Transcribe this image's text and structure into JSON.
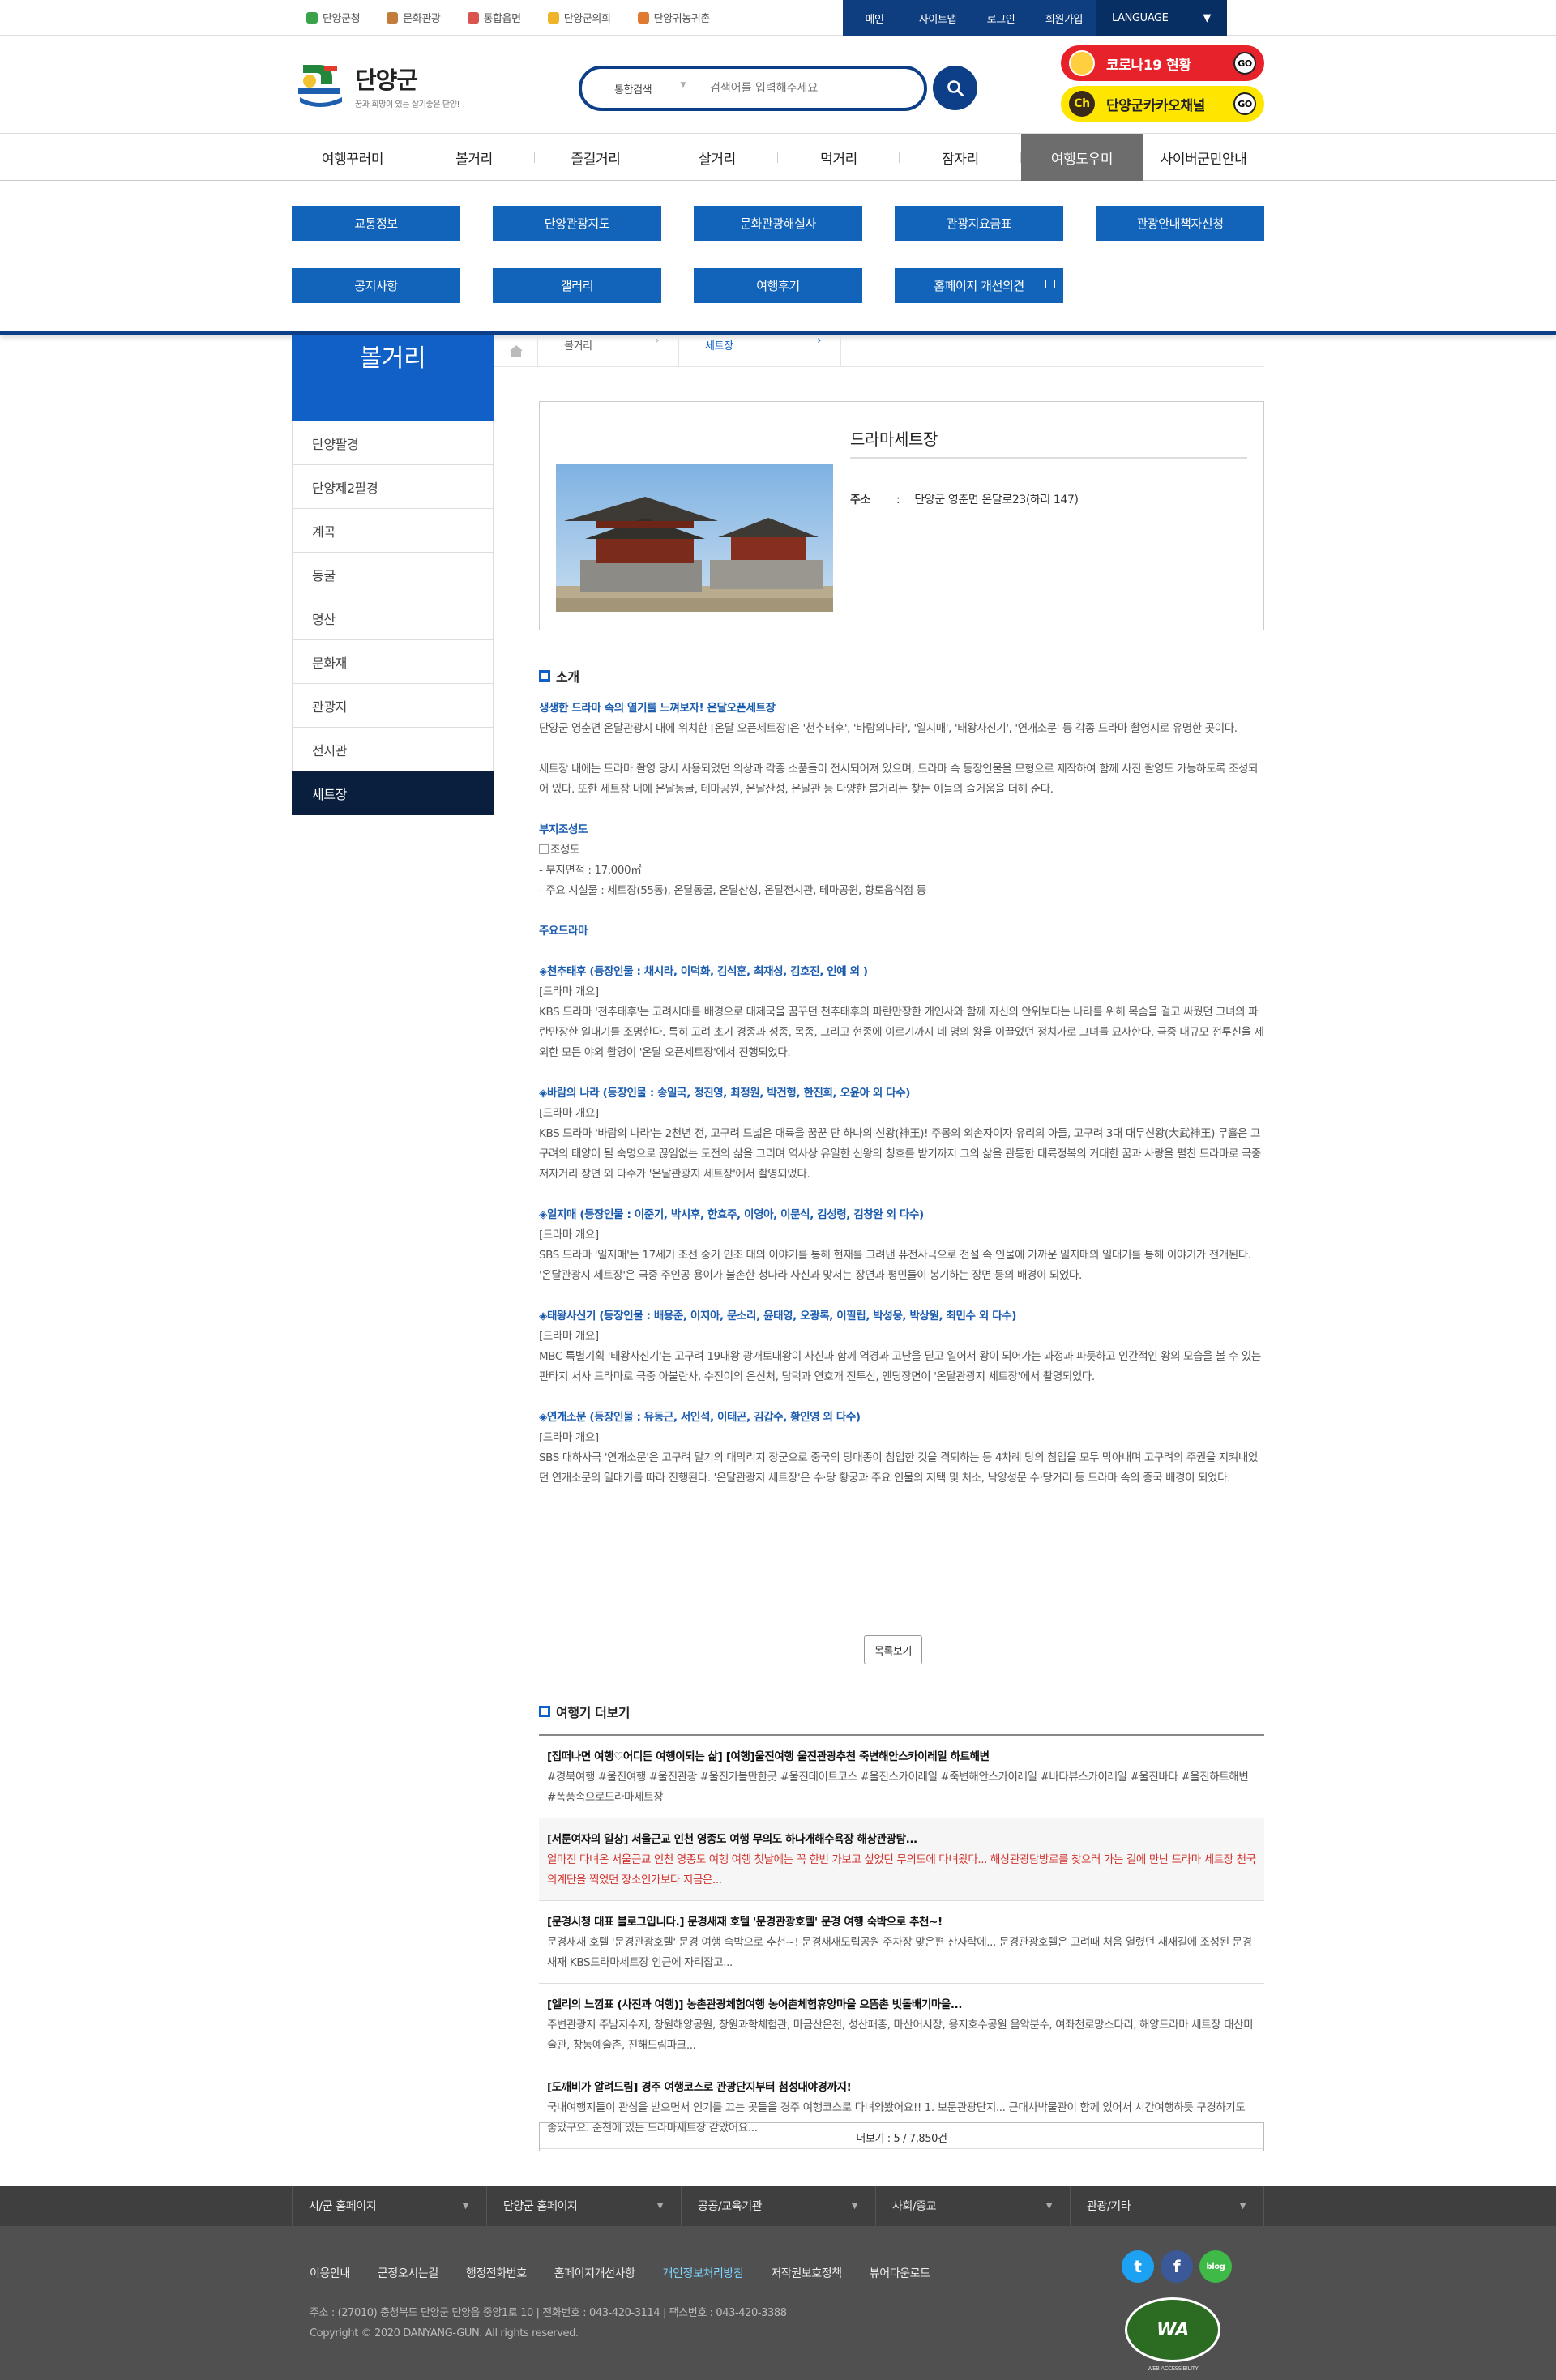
{
  "topbar": {
    "links": [
      "단양군청",
      "문화관광",
      "통합읍면",
      "단양군의회",
      "단양귀농귀촌"
    ],
    "right": [
      "메인",
      "사이트맵",
      "로그인",
      "회원가입"
    ],
    "language": "LANGUAGE"
  },
  "header": {
    "logo_name": "단양군",
    "logo_slogan": "꿈과 희망이 있는 살기좋은 단양!",
    "search_select": "통합검색",
    "search_placeholder": "검색어를 입력해주세요",
    "covid_label": "코로나19 현황",
    "kakao_label": "단양군카카오채널",
    "go": "GO"
  },
  "gnb": [
    "여행꾸러미",
    "볼거리",
    "즐길거리",
    "살거리",
    "먹거리",
    "잠자리",
    "여행도우미",
    "사이버군민안내"
  ],
  "submenu": [
    "교통정보",
    "단양관광지도",
    "문화관광해설사",
    "관광지요금표",
    "관광안내책자신청",
    "공지사항",
    "갤러리",
    "여행후기",
    "홈페이지 개선의견"
  ],
  "lnb": {
    "title": "볼거리",
    "items": [
      "단양팔경",
      "단양제2팔경",
      "계곡",
      "동굴",
      "명산",
      "문화재",
      "관광지",
      "전시관",
      "세트장"
    ]
  },
  "breadcrumb": [
    "볼거리",
    "세트장"
  ],
  "info": {
    "title": "드라마세트장",
    "addr_label": "주소",
    "addr_sep": ":",
    "addr_value": "단양군 영춘면 온달로23(하리 147)"
  },
  "intro": {
    "heading": "소개",
    "lead": "생생한 드라마 속의 열기를 느껴보자! 온달오픈세트장",
    "p1": "단양군 영춘면 온달관광지 내에 위치한 [온달 오픈세트장]은 '천추태후', '바람의나라', '일지매', '태왕사신기', '연개소문' 등 각종 드라마 촬영지로 유명한 곳이다.",
    "p2": "세트장 내에는 드라마 촬영 당시 사용되었던 의상과 각종 소품들이 전시되어져 있으며, 드라마 속 등장인물을 모형으로 제작하여 함께 사진 촬영도 가능하도록 조성되어 있다. 또한 세트장 내에 온달동굴, 테마공원, 온달산성, 온달관 등 다양한 볼거리는 찾는 이들의 즐거움을 더해 준다.",
    "site_title": "부지조성도",
    "site_img_alt": "조성도",
    "site_area": "- 부지면적 : 17,000㎡",
    "site_facilities": "- 주요 시설물 : 세트장(55동), 온달동굴, 온달산성, 온달전시관, 테마공원, 향토음식점 등",
    "drama_title": "주요드라마",
    "overview_label": "[드라마 개요]",
    "dramas": [
      {
        "title": "◈천추태후 (등장인물 : 채시라, 이덕화, 김석훈, 최재성, 김호진, 인예 외 )",
        "text": "KBS 드라마 '천추태후'는 고려시대를 배경으로 대제국을 꿈꾸던 천추태후의 파란만장한 개인사와 함께 자신의 안위보다는 나라를 위해 목숨을 걸고 싸웠던 그녀의 파란만장한 일대기를 조명한다. 특히 고려 초기 경종과 성종, 목종, 그리고 현종에 이르기까지 네 명의 왕을 이끌었던 정치가로 그녀를 묘사한다. 극중 대규모 전투신을 제외한 모든 야외 촬영이 '온달 오픈세트장'에서 진행되었다."
      },
      {
        "title": "◈바람의 나라 (등장인물 : 송일국, 정진영, 최정원, 박건형, 한진희, 오윤아 외 다수)",
        "text": "KBS 드라마 '바람의 나라'는 2천년 전, 고구려 드넓은 대륙을 꿈꾼 단 하나의 신왕(神王)! 주몽의 외손자이자 유리의 아들, 고구려 3대 대무신왕(大武神王) 무휼은 고구려의 태양이 될 숙명으로 끊임없는 도전의 삶을 그리며 역사상 유일한 신왕의 칭호를 받기까지 그의 삶을 관통한 대륙정복의 거대한 꿈과 사랑을 펼친 드라마로 극중 저자거리 장면 외 다수가 '온달관광지 세트장'에서 촬영되었다."
      },
      {
        "title": "◈일지매 (등장인물 : 이준기, 박시후, 한효주, 이영아, 이문식, 김성령, 김창완 외 다수)",
        "text": "SBS 드라마 '일지매'는 17세기 조선 중기 인조 대의 이야기를 통해 현재를 그려낸 퓨전사극으로 전설 속 인물에 가까운 일지매의 일대기를 통해 이야기가 전개된다. '온달관광지 세트장'은 극중 주인공 용이가 불손한 청나라 사신과 맞서는 장면과 평민들이 봉기하는 장면 등의 배경이 되었다."
      },
      {
        "title": "◈태왕사신기 (등장인물 : 배용준, 이지아, 문소리, 윤태영, 오광록, 이필립, 박성웅, 박상원, 최민수 외 다수)",
        "text": "MBC 특별기획 '태왕사신기'는 고구려 19대왕 광개토대왕이 사신과 함께 역경과 고난을 딛고 일어서 왕이 되어가는 과정과 파듯하고 인간적인 왕의 모습을 볼 수 있는 판타지 서사 드라마로 극중 아불란사, 수진이의 은신처, 담덕과 연호개 전투신, 엔딩장면이 '온달관광지 세트장'에서 촬영되었다."
      },
      {
        "title": "◈연개소문 (등장인물 : 유동근, 서인석, 이태곤, 김갑수, 황인영 외 다수)",
        "text": "SBS 대하사극 '연개소문'은 고구려 말기의 대막리지 장군으로 중국의 당대종이 침입한 것을 격퇴하는 등 4차례 당의 침입을 모두 막아내며 고구려의 주권을 지켜내었던 연개소문의 일대기를 따라 진행된다. '온달관광지 세트장'은 수·당 황궁과 주요 인물의 저택 및 처소, 낙양성문 수·당거리 등 드라마 속의 중국 배경이 되었다."
      }
    ]
  },
  "list_button": "목록보기",
  "blog": {
    "heading": "여행기 더보기",
    "items": [
      {
        "title": "[집떠나면 여행♡어디든 여행이되는 삶] [여행]울진여행 울진관광추천 죽변해안스카이레일 하트해변",
        "body": "#경북여행 #울진여행 #울진관광 #울진가볼만한곳 #울진데이트코스 #울진스카이레일 #죽변해안스카이레일 #바다뷰스카이레일 #울진바다 #울진하트해변 #폭풍속으로드라마세트장"
      },
      {
        "title": "[서툰여자의 일상] 서울근교 인천 영종도 여행 무의도 하나개해수욕장 해상관광탐...",
        "body": "얼마전 다녀온 서울근교 인천 영종도 여행 여행 첫날에는 꼭 한번 가보고 싶었던 무의도에 다녀왔다... 해상관광탐방로를 찾으러 가는 길에 만난 드라마 세트장 천국의계단을 찍었던 장소인가보다 지금은..."
      },
      {
        "title": "[문경시청 대표 블로그입니다.] 문경새재 호텔 '문경관광호텔' 문경 여행 숙박으로 추천~!",
        "body": "문경새재 호텔 '문경관광호텔' 문경 여행 숙박으로 추천~! 문경새재도립공원 주차장 맞은편 산자락에... 문경관광호텔은 고려때 처음 열렸던 새재길에 조성된 문경새재 KBS드라마세트장 인근에 자리잡고..."
      },
      {
        "title": "[엘리의 느낌표 (사진과 여행)] 농촌관광체험여행 농어촌체험휴양마을 으뜸촌 빗돌배기마을...",
        "body": "주변관광지 주남저수지, 창원해양공원, 창원과학체험관, 마금산온천, 성산패총, 마산어시장, 용지호수공원 음악분수, 여좌천로망스다리, 해양드라마 세트장 대산미술관, 창동예술촌, 진해드림파크..."
      },
      {
        "title": "[도깨비가 알려드림] 경주 여행코스로 관광단지부터 첨성대야경까지!",
        "body": "국내여행지들이 관심을 받으면서 인기를 끄는 곳들을 경주 여행코스로 다녀와봤어요!! 1. 보문관광단지... 근대사박물관이 함께 있어서 시간여행하듯 구경하기도 좋았구요. 순천에 있는 드라마세트장 같았어요..."
      }
    ],
    "more": "더보기 : 5 / 7,850건"
  },
  "footer": {
    "selects": [
      "시/군 홈페이지",
      "단양군 홈페이지",
      "공공/교육기관",
      "사회/종교",
      "관광/기타"
    ],
    "links": [
      "이용안내",
      "군정오시는길",
      "행정전화번호",
      "홈페이지개선사항",
      "개인정보처리방침",
      "저작권보호정책",
      "뷰어다운로드"
    ],
    "address": "주소 : (27010) 충청북도 단양군 단양읍 중앙1로 10 | 전화번호 : 043-420-3114 | 팩스번호 : 043-420-3388",
    "copyright": "Copyright © 2020 DANYANG-GUN. All rights reserved.",
    "wa": "WA",
    "wa_text": "WEB ACCESSIBILITY",
    "sns_twitter": "t",
    "sns_facebook": "f",
    "sns_blog": "blog"
  },
  "colors": {
    "primary": "#1060c8",
    "navy": "#0d3f88",
    "sub_btn": "#1263ba",
    "active_lnb": "#0a1f3d",
    "covid": "#e8222a",
    "kakao": "#ffe600"
  }
}
